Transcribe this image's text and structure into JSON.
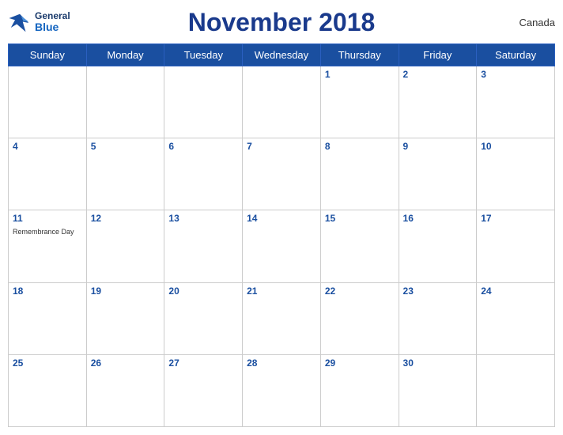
{
  "header": {
    "title": "November 2018",
    "country": "Canada",
    "logo": {
      "line1": "General",
      "line2": "Blue"
    }
  },
  "weekdays": [
    "Sunday",
    "Monday",
    "Tuesday",
    "Wednesday",
    "Thursday",
    "Friday",
    "Saturday"
  ],
  "weeks": [
    [
      {
        "day": "",
        "holiday": ""
      },
      {
        "day": "",
        "holiday": ""
      },
      {
        "day": "",
        "holiday": ""
      },
      {
        "day": "",
        "holiday": ""
      },
      {
        "day": "1",
        "holiday": ""
      },
      {
        "day": "2",
        "holiday": ""
      },
      {
        "day": "3",
        "holiday": ""
      }
    ],
    [
      {
        "day": "4",
        "holiday": ""
      },
      {
        "day": "5",
        "holiday": ""
      },
      {
        "day": "6",
        "holiday": ""
      },
      {
        "day": "7",
        "holiday": ""
      },
      {
        "day": "8",
        "holiday": ""
      },
      {
        "day": "9",
        "holiday": ""
      },
      {
        "day": "10",
        "holiday": ""
      }
    ],
    [
      {
        "day": "11",
        "holiday": "Remembrance Day"
      },
      {
        "day": "12",
        "holiday": ""
      },
      {
        "day": "13",
        "holiday": ""
      },
      {
        "day": "14",
        "holiday": ""
      },
      {
        "day": "15",
        "holiday": ""
      },
      {
        "day": "16",
        "holiday": ""
      },
      {
        "day": "17",
        "holiday": ""
      }
    ],
    [
      {
        "day": "18",
        "holiday": ""
      },
      {
        "day": "19",
        "holiday": ""
      },
      {
        "day": "20",
        "holiday": ""
      },
      {
        "day": "21",
        "holiday": ""
      },
      {
        "day": "22",
        "holiday": ""
      },
      {
        "day": "23",
        "holiday": ""
      },
      {
        "day": "24",
        "holiday": ""
      }
    ],
    [
      {
        "day": "25",
        "holiday": ""
      },
      {
        "day": "26",
        "holiday": ""
      },
      {
        "day": "27",
        "holiday": ""
      },
      {
        "day": "28",
        "holiday": ""
      },
      {
        "day": "29",
        "holiday": ""
      },
      {
        "day": "30",
        "holiday": ""
      },
      {
        "day": "",
        "holiday": ""
      }
    ]
  ]
}
